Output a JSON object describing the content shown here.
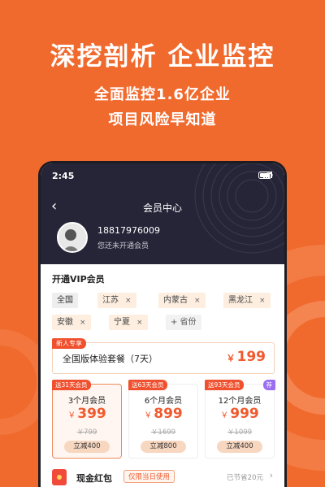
{
  "promo": {
    "headline": "深挖剖析 企业监控",
    "subline1": "全面监控1.6亿企业",
    "subline2": "项目风险早知道"
  },
  "status_bar": {
    "time": "2:45"
  },
  "nav": {
    "back_icon": "‹",
    "title": "会员中心"
  },
  "user": {
    "phone": "18817976009",
    "vip_status": "您还未开通会员"
  },
  "vip": {
    "section_title": "开通VIP会员",
    "regions": [
      {
        "label": "全国"
      },
      {
        "label": "江苏"
      },
      {
        "label": "内蒙古"
      },
      {
        "label": "黑龙江"
      },
      {
        "label": "安徽"
      },
      {
        "label": "宁夏"
      }
    ],
    "remove_icon": "×",
    "add_region_label": "+ 省份",
    "trial": {
      "badge": "新人专享",
      "name": "全国版体验套餐（7天）",
      "currency": "￥",
      "price": "199"
    },
    "plans": [
      {
        "badge": "送31天会员",
        "name": "3个月会员",
        "currency": "￥",
        "price": "399",
        "original": "￥799",
        "discount": "立减400"
      },
      {
        "badge": "送63天会员",
        "name": "6个月会员",
        "currency": "￥",
        "price": "899",
        "original": "￥1699",
        "discount": "立减800"
      },
      {
        "badge": "送93天会员",
        "recommend": "荐",
        "name": "12个月会员",
        "currency": "￥",
        "price": "999",
        "original": "￥1099",
        "discount": "立减400"
      }
    ]
  },
  "red_packet": {
    "title": "现金红包",
    "tag": "仅限当日使用",
    "saved": "已节省20元",
    "arrow": "›"
  },
  "colors": {
    "brand_orange": "#f06a2e",
    "header_dark": "#262538",
    "price_red": "#f05a2e"
  }
}
